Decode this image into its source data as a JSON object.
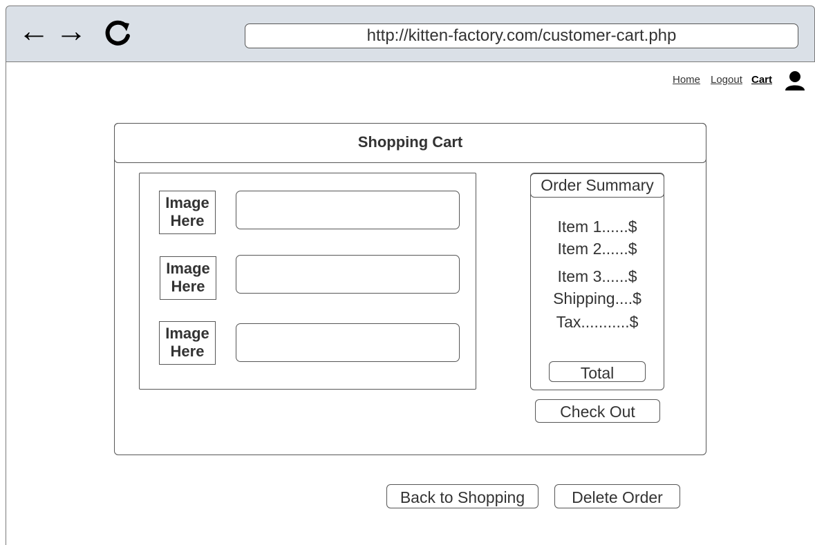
{
  "browser": {
    "url": "http://kitten-factory.com/customer-cart.php",
    "back_glyph": "←",
    "forward_glyph": "→",
    "reload_glyph": "⟳"
  },
  "topnav": {
    "home": "Home",
    "logout": "Logout",
    "cart": "Cart"
  },
  "cart": {
    "title": "Shopping Cart",
    "items": [
      {
        "image_label": "Image Here"
      },
      {
        "image_label": "Image Here"
      },
      {
        "image_label": "Image Here"
      }
    ]
  },
  "summary": {
    "title": "Order Summary",
    "lines": [
      "Item 1......$",
      "Item 2......$",
      "Item 3......$",
      "Shipping....$",
      "Tax...........$"
    ],
    "total_label": "Total",
    "checkout_label": "Check Out"
  },
  "actions": {
    "back_label": "Back to Shopping",
    "delete_label": "Delete Order"
  }
}
